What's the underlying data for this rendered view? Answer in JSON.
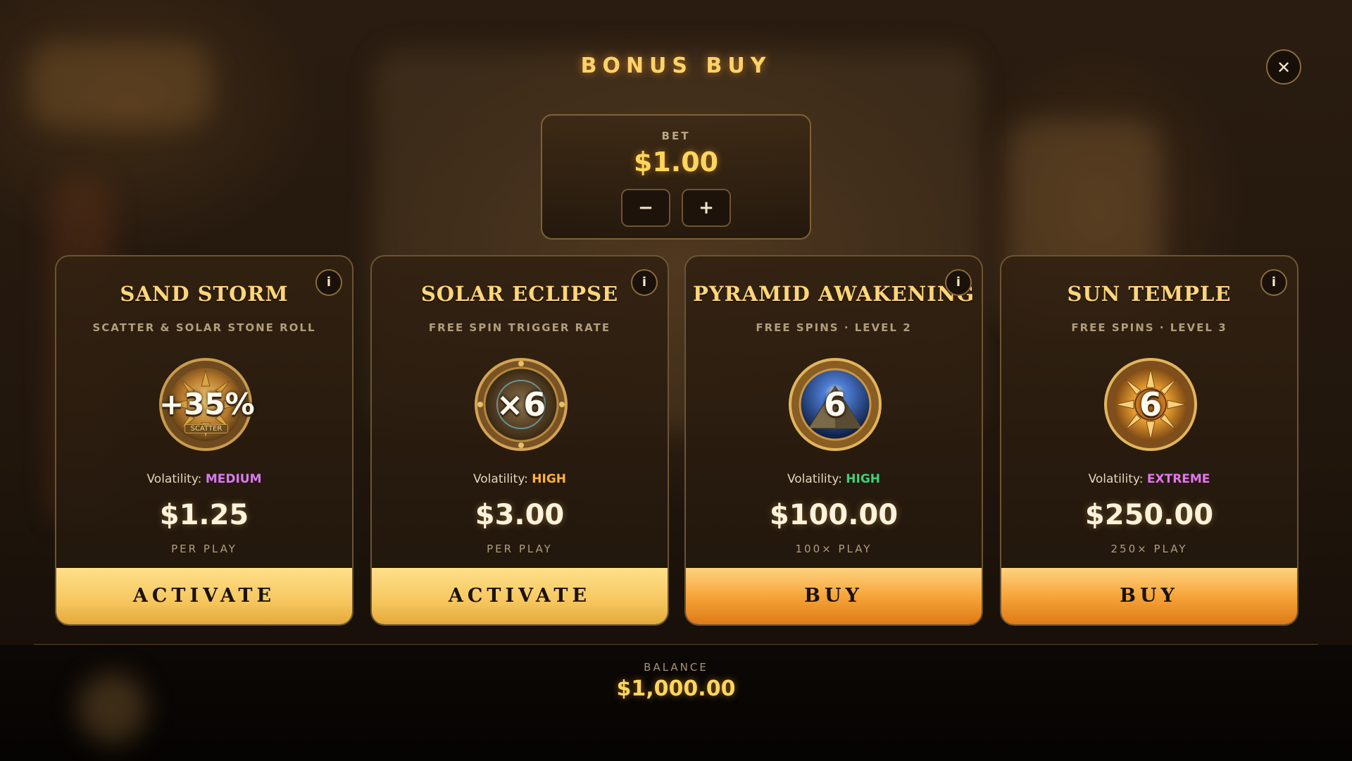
{
  "header": {
    "title": "BONUS BUY",
    "close_symbol": "✕"
  },
  "bet": {
    "label": "BET",
    "value": "$1.00",
    "minus": "−",
    "plus": "+"
  },
  "cards": [
    {
      "title": "SAND STORM",
      "subtitle": "SCATTER & SOLAR STONE ROLL",
      "medal_text": "+35%",
      "medal_sub": "SCATTER",
      "medal_icon": "sun-scatter-medal-icon",
      "volatility_label": "Volatility:",
      "volatility": "MEDIUM",
      "volatility_color": "#d77bf0",
      "price": "$1.25",
      "price_note": "PER PLAY",
      "button": "ACTIVATE",
      "button_style": "gold"
    },
    {
      "title": "SOLAR ECLIPSE",
      "subtitle": "FREE SPIN TRIGGER RATE",
      "medal_text": "×6",
      "medal_icon": "eclipse-compass-medal-icon",
      "volatility_label": "Volatility:",
      "volatility": "HIGH",
      "volatility_color": "#ffb23a",
      "price": "$3.00",
      "price_note": "PER PLAY",
      "button": "ACTIVATE",
      "button_style": "gold"
    },
    {
      "title": "PYRAMID AWAKENING",
      "subtitle": "FREE SPINS · LEVEL 2",
      "medal_text": "6",
      "medal_icon": "pyramid-medal-icon",
      "volatility_label": "Volatility:",
      "volatility": "HIGH",
      "volatility_color": "#3fd07a",
      "price": "$100.00",
      "price_note": "100× PLAY",
      "button": "BUY",
      "button_style": "orange"
    },
    {
      "title": "SUN TEMPLE",
      "subtitle": "FREE SPINS · LEVEL 3",
      "medal_text": "6",
      "medal_icon": "sun-temple-medal-icon",
      "volatility_label": "Volatility:",
      "volatility": "EXTREME",
      "volatility_color": "#e474f0",
      "price": "$250.00",
      "price_note": "250× PLAY",
      "button": "BUY",
      "button_style": "orange"
    }
  ],
  "info_symbol": "i",
  "footer": {
    "balance_label": "BALANCE",
    "balance_value": "$1,000.00"
  }
}
